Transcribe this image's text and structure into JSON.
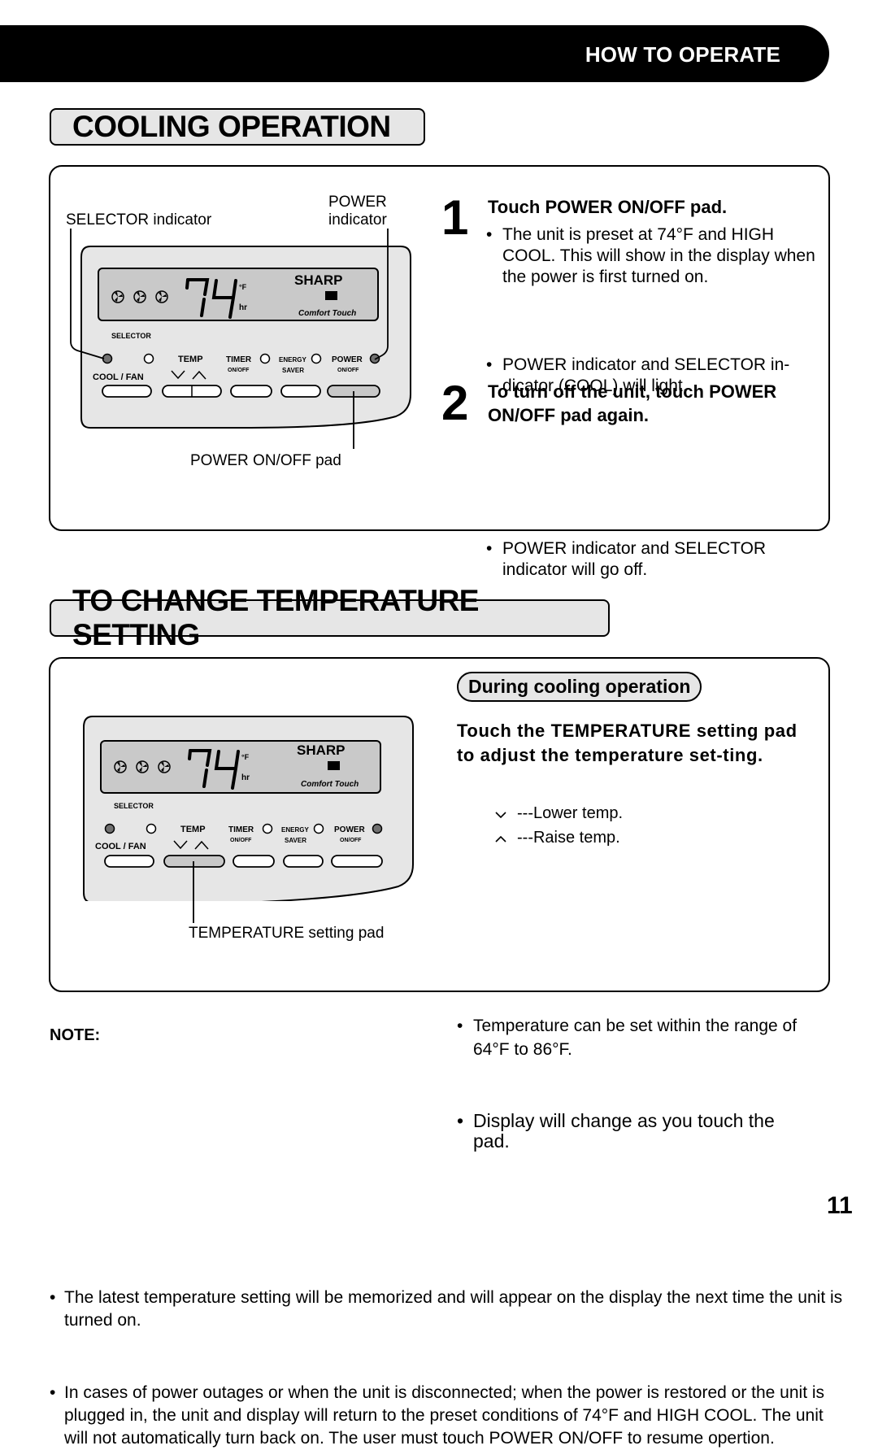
{
  "header": {
    "section_label": "HOW TO OPERATE"
  },
  "cooling": {
    "title": "COOLING OPERATION",
    "callouts": {
      "selector_indicator": "SELECTOR indicator",
      "power_indicator_line1": "POWER",
      "power_indicator_line2": "indicator",
      "power_pad": "POWER ON/OFF pad"
    },
    "steps": [
      {
        "number": "1",
        "heading": "Touch POWER ON/OFF pad.",
        "bullets": [
          "The unit is preset at 74°F  and HIGH COOL.  This will show in the display when the power is first turned on.",
          "POWER indicator and SELECTOR in-dicator (COOL) will light."
        ]
      },
      {
        "number": "2",
        "heading": "To turn off the unit, touch POWER ON/OFF pad again.",
        "bullets": [
          "POWER indicator and SELECTOR indicator will go off."
        ]
      }
    ]
  },
  "panel": {
    "temperature": "74",
    "unit_f": "°F",
    "unit_hr": "hr",
    "brand": "SHARP",
    "tagline": "Comfort Touch",
    "selector_label": "SELECTOR",
    "cool_fan_label": "COOL  /  FAN",
    "temp_label": "TEMP",
    "timer_label": "TIMER",
    "timer_sub": "ON/OFF",
    "energy_label": "ENERGY",
    "energy_sub": "SAVER",
    "power_label": "POWER",
    "power_sub": "ON/OFF",
    "indicator_on_color": "#707070",
    "pressed_pad_color": "#c8c8c8",
    "lcd_color": "#c9c9c9",
    "panel_color": "#e6e6e6"
  },
  "temperature_setting": {
    "title": "TO CHANGE TEMPERATURE SETTING",
    "mode_pill": "During cooling operation",
    "instruction": "Touch the TEMPERATURE setting pad to adjust the temperature set-ting.",
    "legend": [
      {
        "icon": "chevron-down",
        "text": "---Lower temp."
      },
      {
        "icon": "chevron-up",
        "text": "---Raise temp."
      }
    ],
    "bullets": [
      "Temperature can be set within the range of 64°F to 86°F.",
      "Display will change as you touch the pad."
    ],
    "callout": "TEMPERATURE setting pad",
    "range_min": "64°F",
    "range_max": "86°F"
  },
  "note": {
    "title": "NOTE:",
    "items": [
      "The latest temperature setting will be memorized and will appear on the display the next time the unit is turned on.",
      "In cases of power outages or when the unit is disconnected; when the power is restored or the unit is plugged in, the unit and display will return to the preset conditions of 74°F and HIGH COOL. The unit will not automatically turn back on.  The user must touch POWER ON/OFF to resume opertion."
    ]
  },
  "page_number": "11"
}
